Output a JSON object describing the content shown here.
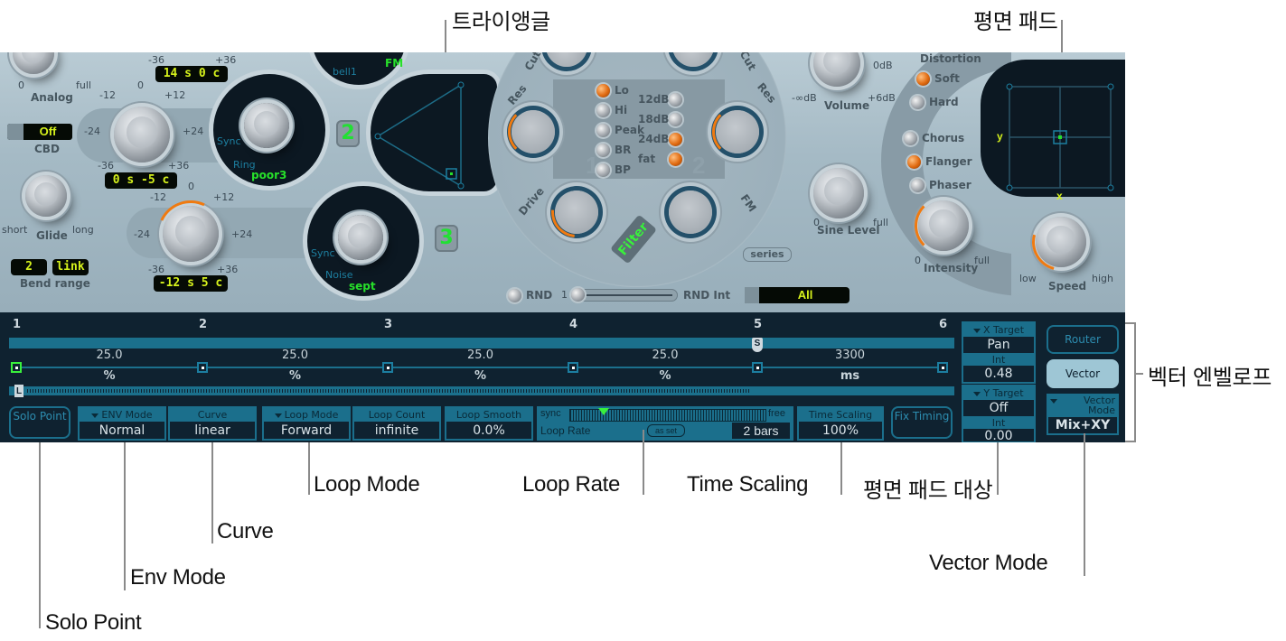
{
  "callouts": {
    "triangle": "트라이앵글",
    "planar_pad": "평면 패드",
    "vector_envelope": "벡터 엔벨로프",
    "solo_point": "Solo Point",
    "env_mode": "Env Mode",
    "curve": "Curve",
    "loop_mode": "Loop Mode",
    "loop_rate": "Loop Rate",
    "time_scaling": "Time Scaling",
    "planar_pad_target": "평면 패드 대상",
    "vector_mode": "Vector Mode"
  },
  "global": {
    "analog": {
      "label": "Analog",
      "min": "0",
      "max": "full"
    },
    "cbd": {
      "label": "CBD",
      "value": "Off"
    },
    "glide": {
      "label": "Glide",
      "min": "short",
      "max": "long"
    },
    "bend_range": {
      "label": "Bend range",
      "up": "2",
      "down": "link"
    }
  },
  "oscillators": {
    "osc1": {
      "tune_display": "14 s  0 c",
      "wave": "bell1",
      "mode": "FM",
      "scale_min": "-36",
      "scale_max": "+36"
    },
    "osc2": {
      "number": "2",
      "tune_display": "0 s  -5 c",
      "wave": "poor3",
      "labels": [
        "Sync",
        "Ring"
      ],
      "scale": {
        "top": "0",
        "m12": "-12",
        "p12": "+12",
        "m24": "-24",
        "p24": "+24",
        "m36": "-36",
        "p36": "+36"
      }
    },
    "osc3": {
      "number": "3",
      "tune_display": "-12 s  5 c",
      "wave": "sept",
      "labels": [
        "Sync",
        "Noise"
      ],
      "scale": {
        "top": "0",
        "m12": "-12",
        "p12": "+12",
        "m24": "-24",
        "p24": "+24",
        "m36": "-36",
        "p36": "+36"
      }
    }
  },
  "filter": {
    "button": "Filter",
    "series": "series",
    "filter1": {
      "number": "1",
      "res": "Res",
      "cut": "Cut",
      "drive": "Drive",
      "types": [
        {
          "label": "Lo",
          "on": true
        },
        {
          "label": "Hi",
          "on": false
        },
        {
          "label": "Peak",
          "on": false
        },
        {
          "label": "BR",
          "on": false
        },
        {
          "label": "BP",
          "on": false
        }
      ]
    },
    "filter2": {
      "number": "2",
      "res": "Res",
      "cut": "Cut",
      "fm": "FM",
      "slopes": [
        {
          "label": "12dB",
          "on": false
        },
        {
          "label": "18dB",
          "on": false
        },
        {
          "label": "24dB",
          "on": true
        },
        {
          "label": "fat",
          "on": true
        }
      ]
    }
  },
  "rnd": {
    "label": "RND",
    "slider_min": "1",
    "int_label": "RND Int",
    "target": "All"
  },
  "output": {
    "volume": {
      "label": "Volume",
      "min": "-∞dB",
      "max": "+6dB",
      "top": "0dB"
    },
    "sine_level": {
      "label": "Sine Level",
      "min": "0",
      "max": "full"
    },
    "distortion": {
      "label": "Distortion",
      "options": [
        {
          "label": "Soft",
          "on": true
        },
        {
          "label": "Hard",
          "on": false
        }
      ]
    },
    "effects": [
      {
        "label": "Chorus",
        "on": false
      },
      {
        "label": "Flanger",
        "on": true
      },
      {
        "label": "Phaser",
        "on": false
      }
    ],
    "intensity": {
      "label": "Intensity",
      "min": "0",
      "max": "full"
    },
    "speed": {
      "label": "Speed",
      "min": "low",
      "max": "high"
    }
  },
  "planar_pad": {
    "x_label": "x",
    "y_label": "y"
  },
  "vector_env": {
    "timeline": [
      "1",
      "2",
      "3",
      "4",
      "5",
      "6"
    ],
    "loop_marker": "L",
    "sustain_marker": "S",
    "segments": [
      {
        "value": "25.0",
        "unit": "%"
      },
      {
        "value": "25.0",
        "unit": "%"
      },
      {
        "value": "25.0",
        "unit": "%"
      },
      {
        "value": "25.0",
        "unit": "%"
      },
      {
        "value": "3300",
        "unit": "ms"
      }
    ],
    "solo_point": "Solo Point",
    "env_mode": {
      "label": "ENV Mode",
      "value": "Normal"
    },
    "curve": {
      "label": "Curve",
      "value": "linear"
    },
    "loop_mode": {
      "label": "Loop Mode",
      "value": "Forward"
    },
    "loop_count": {
      "label": "Loop Count",
      "value": "infinite"
    },
    "loop_smooth": {
      "label": "Loop Smooth",
      "value": "0.0%"
    },
    "loop_rate": {
      "label": "Loop Rate",
      "sync": "sync",
      "free": "free",
      "as_set": "as set",
      "value": "2 bars",
      "position": 0.17
    },
    "time_scaling": {
      "label": "Time Scaling",
      "value": "100%"
    },
    "fix_timing": "Fix Timing",
    "x_target": {
      "label": "X Target",
      "value": "Pan",
      "int_label": "Int",
      "int": "0.48"
    },
    "y_target": {
      "label": "Y Target",
      "value": "Off",
      "int_label": "Int",
      "int": "0.00"
    },
    "router": "Router",
    "vector": "Vector",
    "vector_mode": {
      "label": "Vector Mode",
      "value": "Mix+XY"
    }
  }
}
